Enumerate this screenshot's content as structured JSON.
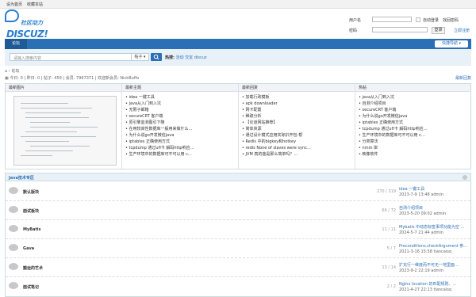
{
  "topbar": {
    "home": "设为首页",
    "bookmark": "收藏本站"
  },
  "logo": {
    "cn": "社区动力",
    "en": "DISCUZ!"
  },
  "login": {
    "user_label": "用户名",
    "pass_label": "密码",
    "auto_login": "自动登录",
    "find_password": "找回密码",
    "register": "立即注册",
    "submit": "登录"
  },
  "nav": {
    "home": "论坛",
    "quick": "快捷导航"
  },
  "search": {
    "placeholder": "请输入搜索内容",
    "type": "帖子",
    "hot_label": "热搜:",
    "hot": [
      "活动",
      "交友",
      "discuz"
    ]
  },
  "breadcrumb": "论坛",
  "stats": {
    "today": "今日: 0",
    "yesterday": "昨日: 0",
    "posts": "帖子: 459",
    "members": "会员: 7967371",
    "newest": "欢迎新会员: NickBuffo",
    "latest_link": "最新回复"
  },
  "grid": {
    "headers": [
      "最新图片",
      "最新主题",
      "最新回复",
      "热帖"
    ],
    "col2": [
      "idea 一键工具",
      "java从入门到入坑",
      "无限子邮箱",
      "secureCRT 客户端",
      "原引擎监测图引下降",
      "在用较高性数据库一般用来做什么…",
      "为什么说go开发微信java",
      "iptables 正确使用方式",
      "tcpdump 通过ufl卡 解码http响应…",
      "生产环境中的数据库可不可以用 c…"
    ],
    "col3": [
      "加载行政模板",
      "apk downloader",
      "网卡配置",
      "稀疏分析",
      "【论道网站推荐】",
      "简体资源",
      "通过设计模式应用实际扒开包-帮",
      "Redis 中的bigkey和hotkey",
      "redis None of slaves were sync…",
      "JVM 真的能是那么简单吗？…"
    ],
    "col4": [
      "java从入门到入坑",
      "自测介绍项目",
      "secureCRT 客户端",
      "为什么说go开发微信java",
      "iptables 正确使用方式",
      "tcpdump 通过ufl卡 解码http响应…",
      "生产环境中的数据库可不可以用 c…",
      "分类算法",
      "nmm 岸",
      "映像软件"
    ]
  },
  "section": {
    "title": "Java技术专区"
  },
  "forums": [
    {
      "name": "默认版块",
      "count": "270 / 319",
      "last_title": "idea 一键工具",
      "last_meta": "2023-7-9 13:48 admin"
    },
    {
      "name": "面试板块",
      "count": "66 / 72",
      "last_title": "自测介绍项目",
      "last_meta": "2023-5-20 09:02 admin"
    },
    {
      "name": "MyBatis",
      "count": "11 / 11",
      "last_title": "Mybatis 中动态标签事项功能为空 …",
      "last_meta": "2024-5-7 21:44 admin"
    },
    {
      "name": "Gava",
      "count": "5 / 7",
      "last_title": "Preconditions.checkArgument 参…",
      "last_meta": "2021-3-16 15:58 tiancaisq"
    },
    {
      "name": "搬运的艺术",
      "count": "13 / 14",
      "last_title": "扩充行一维度而不可无一地里面…",
      "last_meta": "2023-9-2 22:19 admin"
    },
    {
      "name": "面试笔记",
      "count": "2 / 2",
      "last_title": "Nginx location 的匹配规则、…",
      "last_meta": "2021-4-27 22:13 tiancaisq"
    }
  ]
}
